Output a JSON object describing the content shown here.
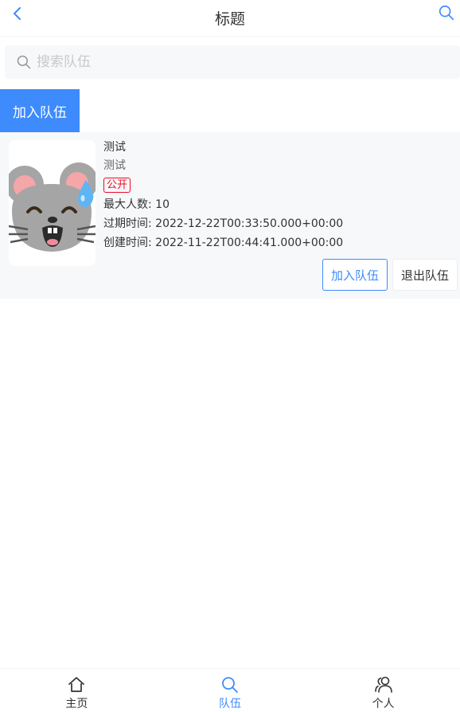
{
  "navbar": {
    "title": "标题",
    "back_icon": "chevron-left-icon",
    "search_icon": "search-icon"
  },
  "search": {
    "placeholder": "搜索队伍",
    "value": ""
  },
  "join_team_label": "加入队伍",
  "team_card": {
    "name": "测试",
    "description": "测试",
    "status_tag": "公开",
    "max_members": "最大人数: 10",
    "expire_time": "过期时间: 2022-12-22T00:33:50.000+00:00",
    "create_time": "创建时间: 2022-11-22T00:44:41.000+00:00",
    "join_label": "加入队伍",
    "quit_label": "退出队伍",
    "avatar_icon": "mouse-face-icon"
  },
  "tabbar": {
    "items": [
      {
        "label": "主页",
        "icon": "home-icon",
        "active": false
      },
      {
        "label": "队伍",
        "icon": "search-icon",
        "active": true
      },
      {
        "label": "个人",
        "icon": "friends-icon",
        "active": false
      }
    ]
  },
  "colors": {
    "primary": "#3d8bfd",
    "danger": "#ee0a24",
    "card_bg": "#f7f8fa",
    "text": "#323233"
  }
}
